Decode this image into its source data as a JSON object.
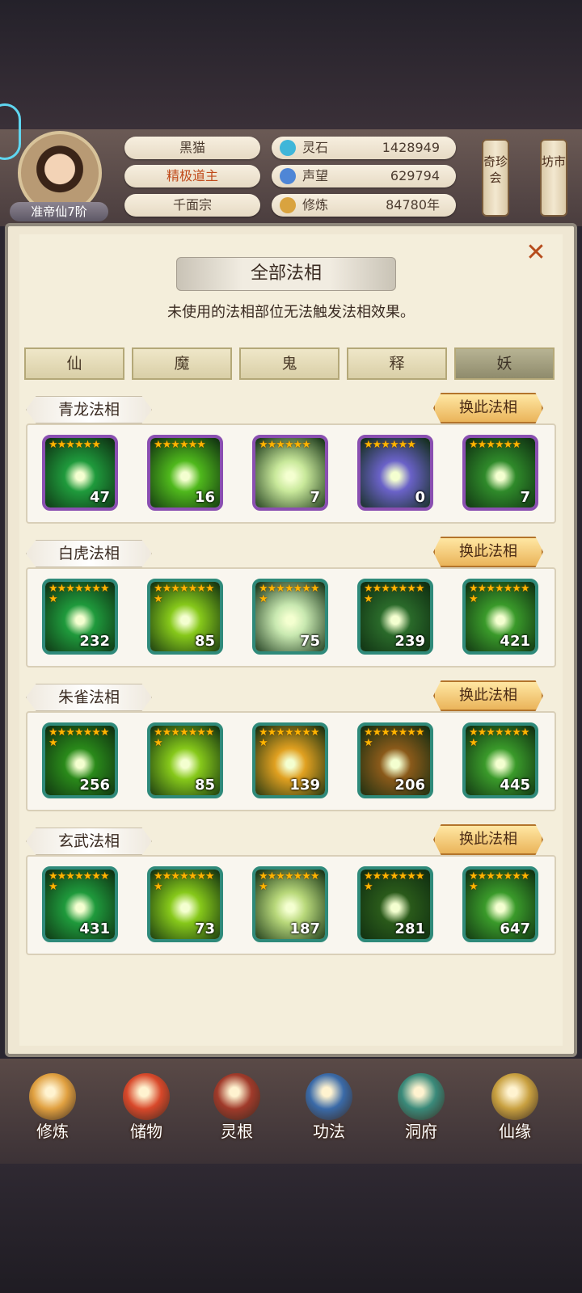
{
  "header": {
    "rank": "准帝仙7阶",
    "name": "黑猫",
    "title": "精极道主",
    "sect": "千面宗",
    "stats": [
      {
        "label": "灵石",
        "value": "1428949",
        "icon": "spirit-stone-icon",
        "color": "#3fb6d9"
      },
      {
        "label": "声望",
        "value": "629794",
        "icon": "prestige-icon",
        "color": "#4f86d6"
      },
      {
        "label": "修炼",
        "value": "84780年",
        "icon": "meditation-icon",
        "color": "#d9a33f"
      }
    ],
    "side_buttons": [
      "奇珍会",
      "坊市"
    ]
  },
  "panel": {
    "title": "全部法相",
    "subtitle": "未使用的法相部位无法触发法相效果。",
    "tabs": [
      "仙",
      "魔",
      "鬼",
      "释",
      "妖"
    ],
    "active_tab": "妖",
    "swap_label": "换此法相",
    "sections": [
      {
        "name": "青龙法相",
        "frame": "purple",
        "items": [
          {
            "count": "47",
            "stars": 6,
            "art": "#1f9a3c"
          },
          {
            "count": "16",
            "stars": 6,
            "art": "#4fb81c"
          },
          {
            "count": "7",
            "stars": 6,
            "art": "#c8e89a"
          },
          {
            "count": "0",
            "stars": 6,
            "art": "#6a62c8"
          },
          {
            "count": "7",
            "stars": 6,
            "art": "#2f8a2a"
          }
        ]
      },
      {
        "name": "白虎法相",
        "frame": "teal",
        "items": [
          {
            "count": "232",
            "stars": 8,
            "art": "#1f9a3c"
          },
          {
            "count": "85",
            "stars": 8,
            "art": "#86c81a"
          },
          {
            "count": "75",
            "stars": 8,
            "art": "#c8e8b0"
          },
          {
            "count": "239",
            "stars": 8,
            "art": "#2a6a2a"
          },
          {
            "count": "421",
            "stars": 8,
            "art": "#3a9a2a"
          }
        ]
      },
      {
        "name": "朱雀法相",
        "frame": "teal",
        "items": [
          {
            "count": "256",
            "stars": 8,
            "art": "#2a8a1a"
          },
          {
            "count": "85",
            "stars": 8,
            "art": "#86c81a"
          },
          {
            "count": "139",
            "stars": 8,
            "art": "#e0a020"
          },
          {
            "count": "206",
            "stars": 8,
            "art": "#8a5a1a"
          },
          {
            "count": "445",
            "stars": 8,
            "art": "#3a9a2a"
          }
        ]
      },
      {
        "name": "玄武法相",
        "frame": "teal",
        "items": [
          {
            "count": "431",
            "stars": 8,
            "art": "#1f9a3c"
          },
          {
            "count": "73",
            "stars": 8,
            "art": "#86c81a"
          },
          {
            "count": "187",
            "stars": 8,
            "art": "#b8d87a"
          },
          {
            "count": "281",
            "stars": 8,
            "art": "#2a5a1a"
          },
          {
            "count": "647",
            "stars": 8,
            "art": "#3a9a2a"
          }
        ]
      }
    ]
  },
  "nav": [
    {
      "label": "修炼",
      "icon": "cultivation-icon",
      "color": "#e0a040"
    },
    {
      "label": "储物",
      "icon": "storage-bag-icon",
      "color": "#d8482a"
    },
    {
      "label": "灵根",
      "icon": "spirit-root-icon",
      "color": "#a03a2a"
    },
    {
      "label": "功法",
      "icon": "technique-book-icon",
      "color": "#3a6aa8"
    },
    {
      "label": "洞府",
      "icon": "cave-dwelling-icon",
      "color": "#3a8a7a"
    },
    {
      "label": "仙缘",
      "icon": "immortal-fate-icon",
      "color": "#c8a040"
    }
  ]
}
